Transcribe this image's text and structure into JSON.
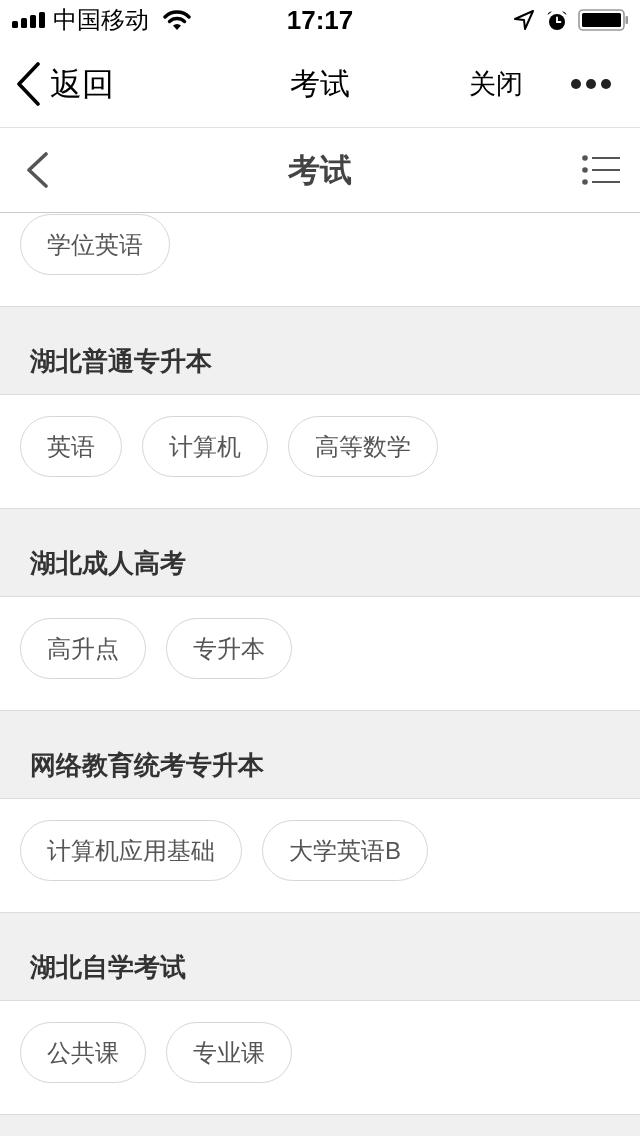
{
  "status_bar": {
    "carrier": "中国移动",
    "time": "17:17"
  },
  "nav_bar": {
    "back_label": "返回",
    "title": "考试",
    "close_label": "关闭"
  },
  "header": {
    "title": "考试"
  },
  "sections": [
    {
      "tags": [
        "学位英语"
      ]
    },
    {
      "title": "湖北普通专升本",
      "tags": [
        "英语",
        "计算机",
        "高等数学"
      ]
    },
    {
      "title": "湖北成人高考",
      "tags": [
        "高升点",
        "专升本"
      ]
    },
    {
      "title": "网络教育统考专升本",
      "tags": [
        "计算机应用基础",
        "大学英语B"
      ]
    },
    {
      "title": "湖北自学考试",
      "tags": [
        "公共课",
        "专业课"
      ]
    }
  ]
}
